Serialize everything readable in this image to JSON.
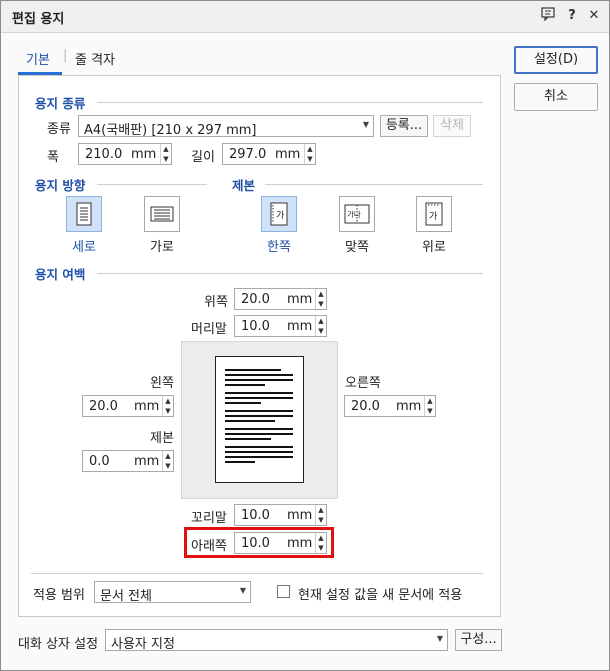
{
  "window": {
    "title": "편집 용지",
    "help_icon_glyph": "?",
    "close_icon_glyph": "✕"
  },
  "tabs": {
    "basic": "기본",
    "grid": "줄 격자"
  },
  "buttons": {
    "ok": "설정(D)",
    "cancel": "취소",
    "register": "등록...",
    "delete": "삭제",
    "configure": "구성..."
  },
  "paper_type": {
    "section": "용지 종류",
    "kind_label": "종류",
    "kind_value": "A4(국배판)  [210 x 297 mm]",
    "width_label": "폭",
    "width_value": "210.0",
    "height_label": "길이",
    "height_value": "297.0",
    "unit": "mm"
  },
  "orientation": {
    "section": "용지 방향",
    "portrait": "세로",
    "landscape": "가로",
    "selected": "portrait"
  },
  "binding": {
    "section": "제본",
    "single": "한쪽",
    "facing": "맞쪽",
    "top": "위로",
    "single_glyph": "가",
    "facing_glyph": "가나",
    "top_glyph": "가",
    "selected": "single"
  },
  "margins": {
    "section": "용지 여백",
    "unit": "mm",
    "top_label": "위쪽",
    "top_value": "20.0",
    "header_label": "머리말",
    "header_value": "10.0",
    "left_label": "왼쪽",
    "left_value": "20.0",
    "binding_label": "제본",
    "binding_value": "0.0",
    "right_label": "오른쪽",
    "right_value": "20.0",
    "footer_label": "꼬리말",
    "footer_value": "10.0",
    "bottom_label": "아래쪽",
    "bottom_value": "10.0"
  },
  "apply": {
    "scope_label": "적용 범위",
    "scope_value": "문서 전체",
    "checkbox_label": "현재 설정 값을 새 문서에 적용",
    "checkbox_checked": false
  },
  "dialog_settings": {
    "label": "대화 상자 설정",
    "value": "사용자 지정"
  },
  "colors": {
    "accent": "#1f4fa8",
    "selected_bg": "#cfe2f7",
    "highlight": "#e01010"
  }
}
